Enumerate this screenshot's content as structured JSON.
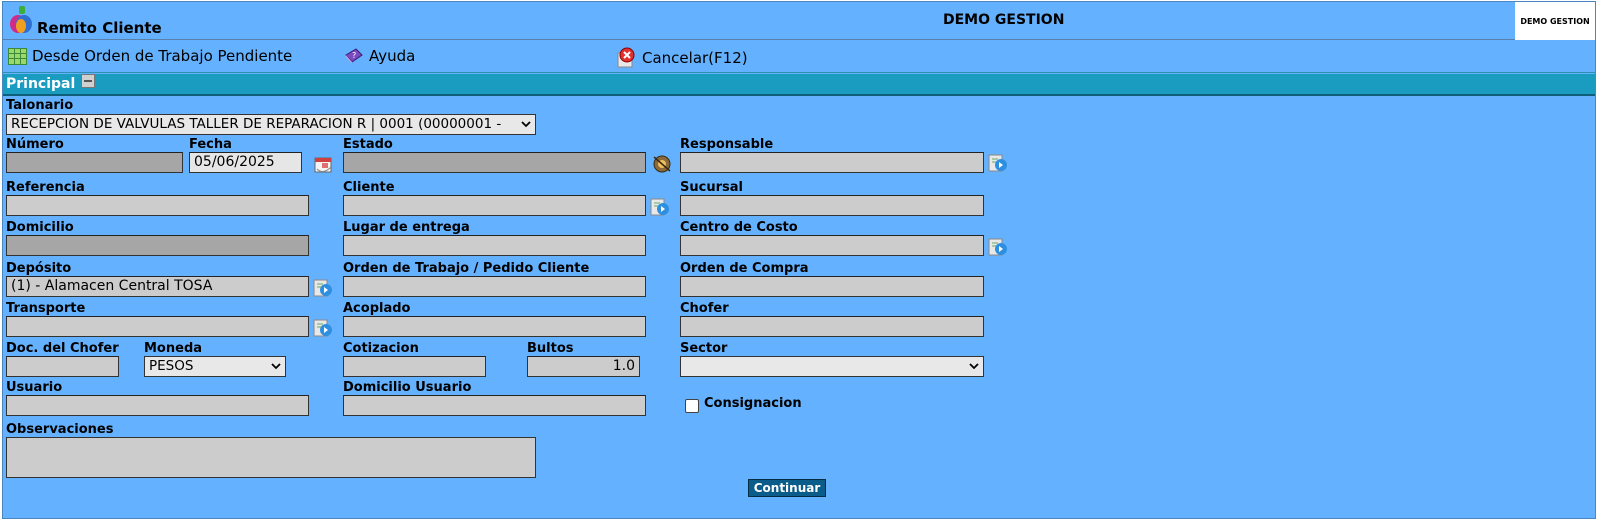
{
  "header": {
    "window_title": "Remito Cliente",
    "company_title": "DEMO GESTION",
    "company_badge": "DEMO GESTION"
  },
  "toolbar": {
    "desde_orden": "Desde Orden de Trabajo Pendiente",
    "ayuda": "Ayuda",
    "cancelar": "Cancelar(F12)"
  },
  "section": {
    "title": "Principal"
  },
  "form": {
    "talonario": {
      "label": "Talonario",
      "value": "RECEPCION DE VALVULAS TALLER DE REPARACION R | 0001 (00000001 -"
    },
    "numero": {
      "label": "Número",
      "value": ""
    },
    "fecha": {
      "label": "Fecha",
      "value": "05/06/2025"
    },
    "estado": {
      "label": "Estado",
      "value": ""
    },
    "responsable": {
      "label": "Responsable",
      "value": ""
    },
    "referencia": {
      "label": "Referencia",
      "value": ""
    },
    "cliente": {
      "label": "Cliente",
      "value": ""
    },
    "sucursal": {
      "label": "Sucursal",
      "value": ""
    },
    "domicilio": {
      "label": "Domicilio",
      "value": ""
    },
    "lugar_entrega": {
      "label": "Lugar de entrega",
      "value": ""
    },
    "centro_costo": {
      "label": "Centro de Costo",
      "value": ""
    },
    "deposito": {
      "label": "Depósito",
      "value": "(1) - Alamacen Central TOSA"
    },
    "orden_trabajo": {
      "label": "Orden de Trabajo / Pedido Cliente",
      "value": ""
    },
    "orden_compra": {
      "label": "Orden de Compra",
      "value": ""
    },
    "transporte": {
      "label": "Transporte",
      "value": ""
    },
    "acoplado": {
      "label": "Acoplado",
      "value": ""
    },
    "chofer": {
      "label": "Chofer",
      "value": ""
    },
    "doc_chofer": {
      "label": "Doc. del Chofer",
      "value": ""
    },
    "moneda": {
      "label": "Moneda",
      "value": "PESOS"
    },
    "cotizacion": {
      "label": "Cotizacion",
      "value": ""
    },
    "bultos": {
      "label": "Bultos",
      "value": "1.0"
    },
    "sector": {
      "label": "Sector",
      "value": ""
    },
    "usuario": {
      "label": "Usuario",
      "value": ""
    },
    "domicilio_usuario": {
      "label": "Domicilio Usuario",
      "value": ""
    },
    "consignacion": {
      "label": "Consignacion",
      "checked": false
    },
    "observaciones": {
      "label": "Observaciones",
      "value": ""
    }
  },
  "actions": {
    "continuar": "Continuar"
  },
  "colors": {
    "background": "#64b2ff",
    "section_bar": "#1a9bc0",
    "button": "#0a5c8a"
  }
}
